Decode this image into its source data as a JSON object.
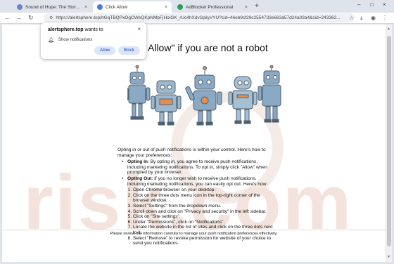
{
  "tabs": [
    {
      "title": "Sound of Hope: The Story of H",
      "active": false,
      "favicon_color": "#6d83c9"
    },
    {
      "title": "Click Allow",
      "active": true,
      "favicon_color": "#4a7bd8"
    },
    {
      "title": "AdBlocker Professional",
      "active": false,
      "favicon_color": "#2f9e55"
    }
  ],
  "tab_close": "×",
  "new_tab": "+",
  "window_controls": {
    "minimize": "–",
    "maximize": "□",
    "close": "×"
  },
  "toolbar": {
    "back": "←",
    "forward": "→",
    "reload": "↻",
    "url": "https://alertsphere.top/hGqTBQPxOgCWeQKpNMpFjHoiGK_rUc4hXdvSpilyVYU?cid=46eb9cf29c2554733e663a57d24a03a4&sid=243362...",
    "star": "☆",
    "download": "⤓",
    "profile": "◉",
    "menu": "⋮"
  },
  "popup": {
    "origin": "alertsphere.top",
    "wants_to": "wants to",
    "close": "×",
    "permission": "Show notifications",
    "bell": "🔔",
    "allow": "Allow",
    "block": "Block"
  },
  "page": {
    "headline": "Allow\" if you are not a robot",
    "watermark": "risk.com",
    "intro": "Opting in or out of push notifications is within your control. Here's how to manage your preferences:",
    "options": [
      {
        "label": "Opting In",
        "text": ": By opting in, you agree to receive push notifications, including marketing notifications. To opt in, simply click \"Allow\" when prompted by your browser."
      },
      {
        "label": "Opting Out",
        "text": ": If you no longer wish to receive push notifications, including marketing notifications, you can easily opt out. Here's how:"
      }
    ],
    "steps": [
      "Open Chrome browser on your desktop.",
      "Click on the three dots menu icon in the top-right corner of the browser window.",
      "Select \"Settings\" from the dropdown menu.",
      "Scroll down and click on \"Privacy and security\" in the left sidebar.",
      "Click on \"Site settings\".",
      "Under \"Permissions\", click on \"Notifications\".",
      "Locate the website in the list of sites and click on the three dots next to it.",
      "Select \"Remove\" to revoke permission for website of your choice to send you notifications."
    ],
    "footer": "Please review this information carefully to manage your push notification preferences effectively."
  },
  "colors": {
    "robot_body": "#8aa9c4",
    "robot_dark": "#4d6072",
    "robot_accent": "#e58f4e"
  }
}
